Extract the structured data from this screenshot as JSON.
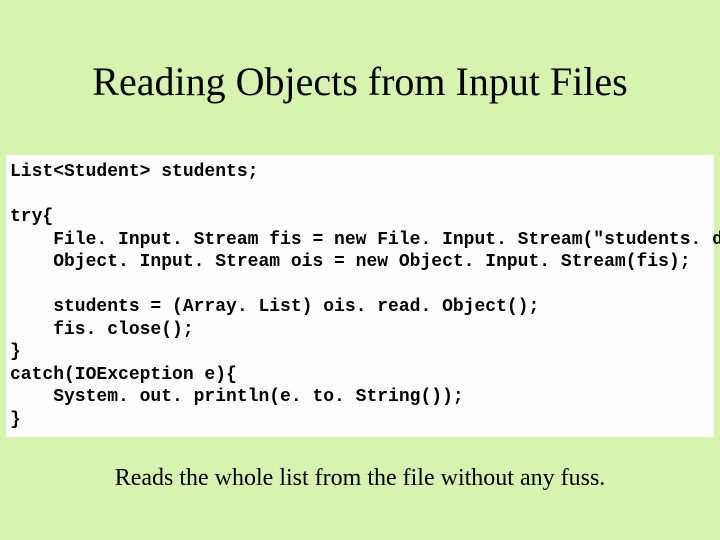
{
  "title": "Reading Objects from Input Files",
  "code": {
    "l1": "List<Student> students;",
    "l2": "",
    "l3": "try{",
    "l4": "    File. Input. Stream fis = new File. Input. Stream(\"students. dat\");",
    "l5": "    Object. Input. Stream ois = new Object. Input. Stream(fis);",
    "l6": "",
    "l7": "    students = (Array. List) ois. read. Object();",
    "l8": "    fis. close();",
    "l9": "}",
    "l10": "catch(IOException e){",
    "l11": "    System. out. println(e. to. String());",
    "l12": "}"
  },
  "caption": "Reads the whole list from the file without any fuss."
}
